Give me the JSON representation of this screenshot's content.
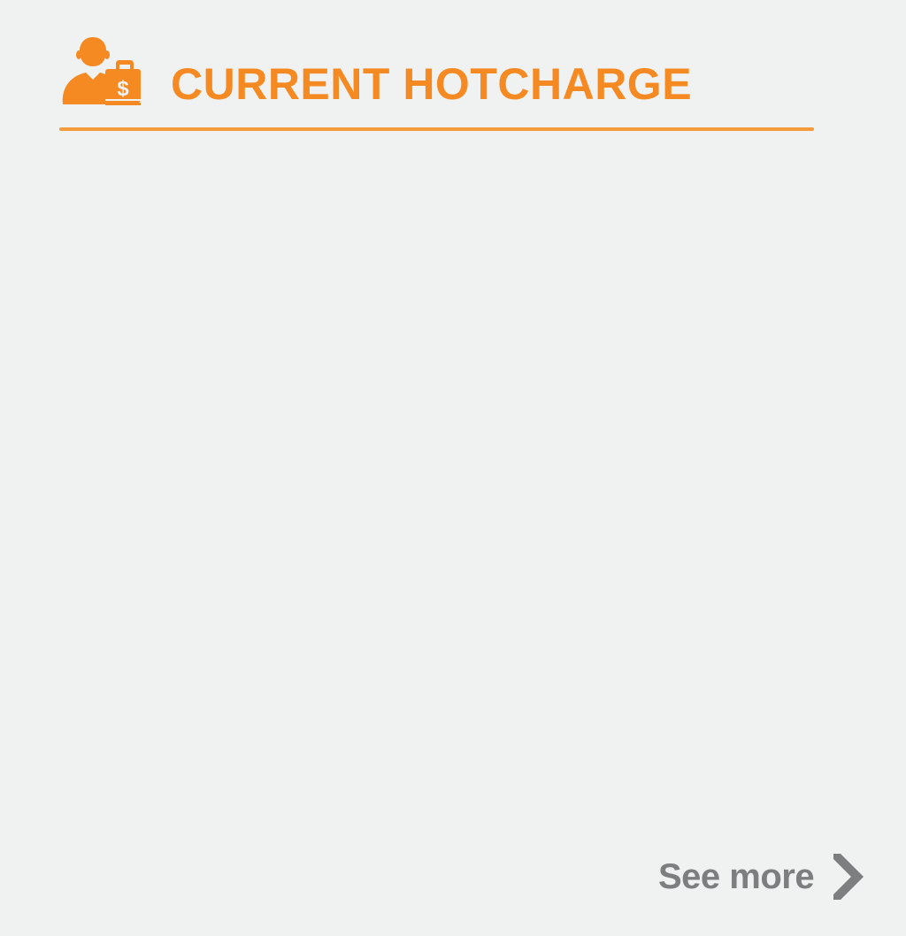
{
  "header": {
    "title": "CURRENT HOTCHARGE",
    "icon": "user-with-money-briefcase-icon"
  },
  "footer": {
    "see_more_label": "See more",
    "chevron_icon": "chevron-right-icon"
  },
  "colors": {
    "accent": "#f58a23",
    "rule": "#f59b3b",
    "muted_text": "#7d7e80",
    "background": "#f0f1f1"
  }
}
